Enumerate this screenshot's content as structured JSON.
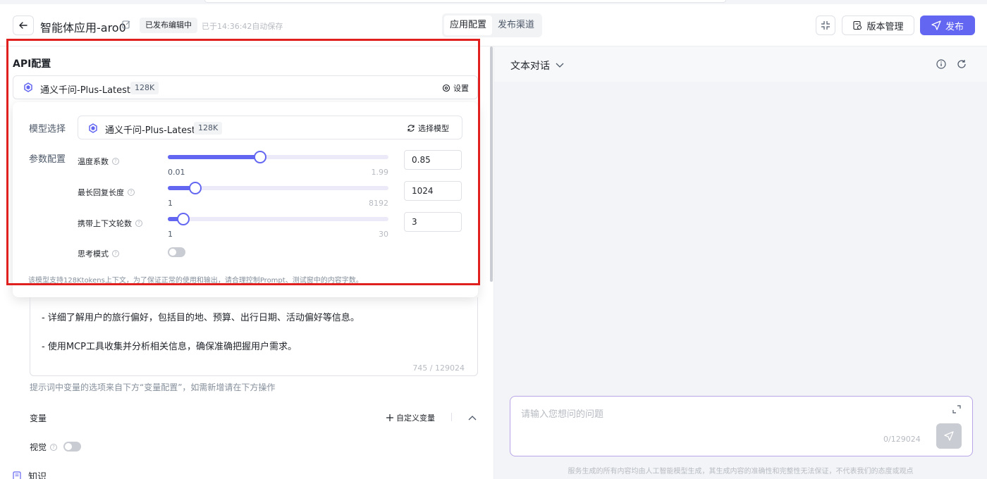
{
  "header": {
    "title": "智能体应用-aro0",
    "status_badge": "已发布编辑中",
    "save_note": "已于14:36:42自动保存",
    "tabs": [
      {
        "label": "应用配置",
        "active": true
      },
      {
        "label": "发布渠道",
        "active": false
      }
    ],
    "version_label": "版本管理",
    "publish_label": "发布"
  },
  "api_config": {
    "title": "API配置",
    "model_name": "通义千问-Plus-Latest",
    "model_tag": "128K",
    "settings_label": "设置"
  },
  "popover": {
    "model_select_label": "模型选择",
    "model_name": "通义千问-Plus-Latest",
    "model_tag": "128K",
    "choose_model_label": "选择模型",
    "params_label": "参数配置",
    "params": [
      {
        "label": "温度系数",
        "min": "0.01",
        "max": "1.99",
        "value": "0.85",
        "fraction": 0.42
      },
      {
        "label": "最长回复长度",
        "min": "1",
        "max": "8192",
        "value": "1024",
        "fraction": 0.125
      },
      {
        "label": "携带上下文轮数",
        "min": "1",
        "max": "30",
        "value": "3",
        "fraction": 0.069
      }
    ],
    "thinking_mode_label": "思考模式",
    "thinking_mode_on": false,
    "note": "该模型支持128Ktokens上下文，为了保证正常的使用和输出，请合理控制Prompt、测试窗中的内容字数。"
  },
  "prompt": {
    "lines": [
      "- 详细了解用户的旅行偏好，包括目的地、预算、出行日期、活动偏好等信息。",
      "- 使用MCP工具收集并分析相关信息，确保准确把握用户需求。"
    ],
    "count": "745 / 129024",
    "hint": "提示词中变量的选项来自下方“变量配置”，如需新增请在下方操作"
  },
  "variables": {
    "title": "变量",
    "custom_label": "自定义变量",
    "vision_label": "视觉",
    "vision_on": false
  },
  "knowledge": {
    "label": "知识"
  },
  "chat": {
    "mode_label": "文本对话",
    "input_placeholder": "请输入您想问的问题",
    "count": "0/129024",
    "disclaimer": "服务生成的所有内容均由人工智能模型生成，其生成内容的准确性和完整性无法保证，不代表我们的态度或观点"
  },
  "colors": {
    "accent": "#6366f1",
    "highlight_frame": "#e0201e"
  }
}
